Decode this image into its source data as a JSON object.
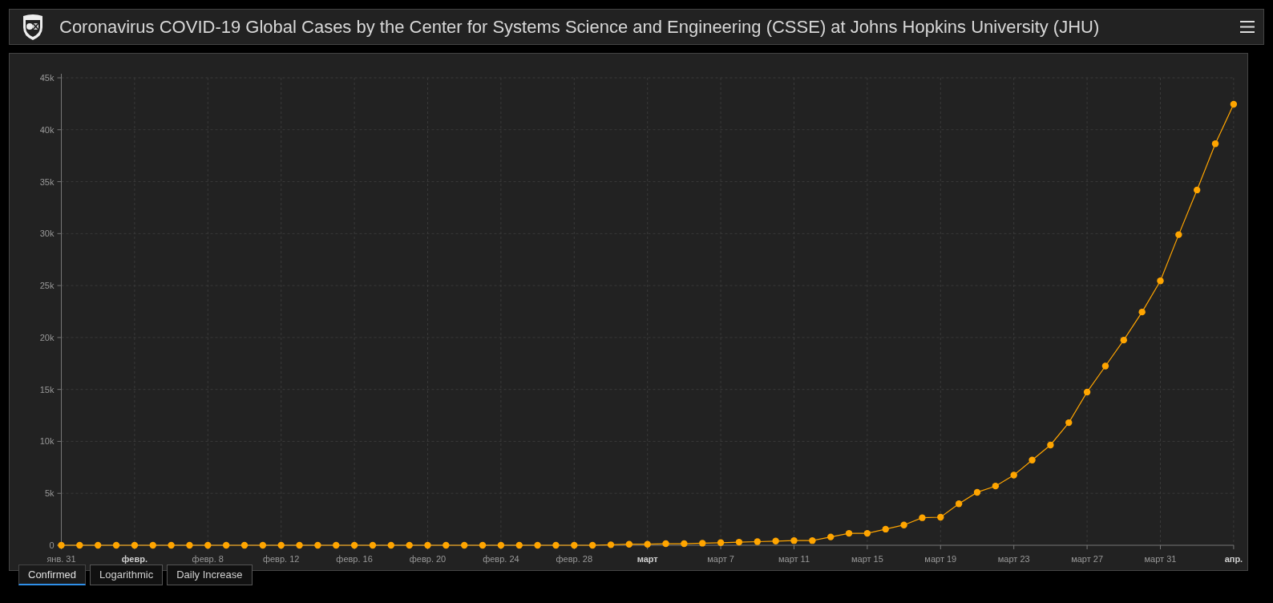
{
  "header": {
    "title": "Coronavirus COVID-19 Global Cases by the Center for Systems Science and Engineering (CSSE) at Johns Hopkins University (JHU)"
  },
  "chart": {
    "chart_data": {
      "type": "line",
      "x": [
        "--01-31",
        "--02-01",
        "--02-02",
        "--02-03",
        "--02-04",
        "--02-05",
        "--02-06",
        "--02-07",
        "--02-08",
        "--02-09",
        "--02-10",
        "--02-11",
        "--02-12",
        "--02-13",
        "--02-14",
        "--02-15",
        "--02-16",
        "--02-17",
        "--02-18",
        "--02-19",
        "--02-20",
        "--02-21",
        "--02-22",
        "--02-23",
        "--02-24",
        "--02-25",
        "--02-26",
        "--02-27",
        "--02-28",
        "--02-29",
        "--03-01",
        "--03-02",
        "--03-03",
        "--03-04",
        "--03-05",
        "--03-06",
        "--03-07",
        "--03-08",
        "--03-09",
        "--03-10",
        "--03-11",
        "--03-12",
        "--03-13",
        "--03-14",
        "--03-15",
        "--03-16",
        "--03-17",
        "--03-18",
        "--03-19",
        "--03-20",
        "--03-21",
        "--03-22",
        "--03-23",
        "--03-24",
        "--03-25",
        "--03-26",
        "--03-27",
        "--03-28",
        "--03-29",
        "--03-30",
        "--03-31",
        "--04-01",
        "--04-02",
        "--04-03",
        "--04-04"
      ],
      "series": [
        {
          "color": "#ffa500",
          "marker": true,
          "values": [
            0,
            0,
            0,
            0,
            0,
            0,
            0,
            0,
            0,
            0,
            0,
            0,
            0,
            0,
            0,
            0,
            0,
            0,
            0,
            0,
            0,
            0,
            0,
            0,
            0,
            0,
            0,
            0,
            0,
            0,
            50,
            100,
            100,
            150,
            150,
            200,
            250,
            300,
            350,
            400,
            450,
            450,
            800,
            1150,
            1150,
            1550,
            1950,
            2650,
            2700,
            4000,
            5100,
            5700,
            6750,
            8200,
            9650,
            11800,
            14750,
            17250,
            19750,
            22450,
            25450,
            29900,
            34200,
            38650,
            42450
          ]
        }
      ],
      "xlim": [
        "--01-31",
        "--04-04"
      ],
      "ylim": [
        0,
        45000
      ],
      "grid": true,
      "yticks": [
        {
          "value": 0,
          "label": "0"
        },
        {
          "value": 5000,
          "label": "5k"
        },
        {
          "value": 10000,
          "label": "10k"
        },
        {
          "value": 15000,
          "label": "15k"
        },
        {
          "value": 20000,
          "label": "20k"
        },
        {
          "value": 25000,
          "label": "25k"
        },
        {
          "value": 30000,
          "label": "30k"
        },
        {
          "value": 35000,
          "label": "35k"
        },
        {
          "value": 40000,
          "label": "40k"
        },
        {
          "value": 45000,
          "label": "45k"
        }
      ],
      "xticks": [
        {
          "value": "--01-31",
          "label": "янв. 31"
        },
        {
          "value": "--02-04",
          "label": "февр."
        },
        {
          "value": "--02-08",
          "label": "февр. 8"
        },
        {
          "value": "--02-12",
          "label": "февр. 12"
        },
        {
          "value": "--02-16",
          "label": "февр. 16"
        },
        {
          "value": "--02-20",
          "label": "февр. 20"
        },
        {
          "value": "--02-24",
          "label": "февр. 24"
        },
        {
          "value": "--02-28",
          "label": "февр. 28"
        },
        {
          "value": "--03-03",
          "label": "март"
        },
        {
          "value": "--03-07",
          "label": "март 7"
        },
        {
          "value": "--03-11",
          "label": "март 11"
        },
        {
          "value": "--03-15",
          "label": "март 15"
        },
        {
          "value": "--03-19",
          "label": "март 19"
        },
        {
          "value": "--03-23",
          "label": "март 23"
        },
        {
          "value": "--03-27",
          "label": "март 27"
        },
        {
          "value": "--03-31",
          "label": "март 31"
        },
        {
          "value": "--04-04",
          "label": "апр."
        }
      ]
    }
  },
  "tabs": [
    {
      "label": "Confirmed",
      "selected": true
    },
    {
      "label": "Logarithmic",
      "selected": false
    },
    {
      "label": "Daily Increase",
      "selected": false
    }
  ]
}
